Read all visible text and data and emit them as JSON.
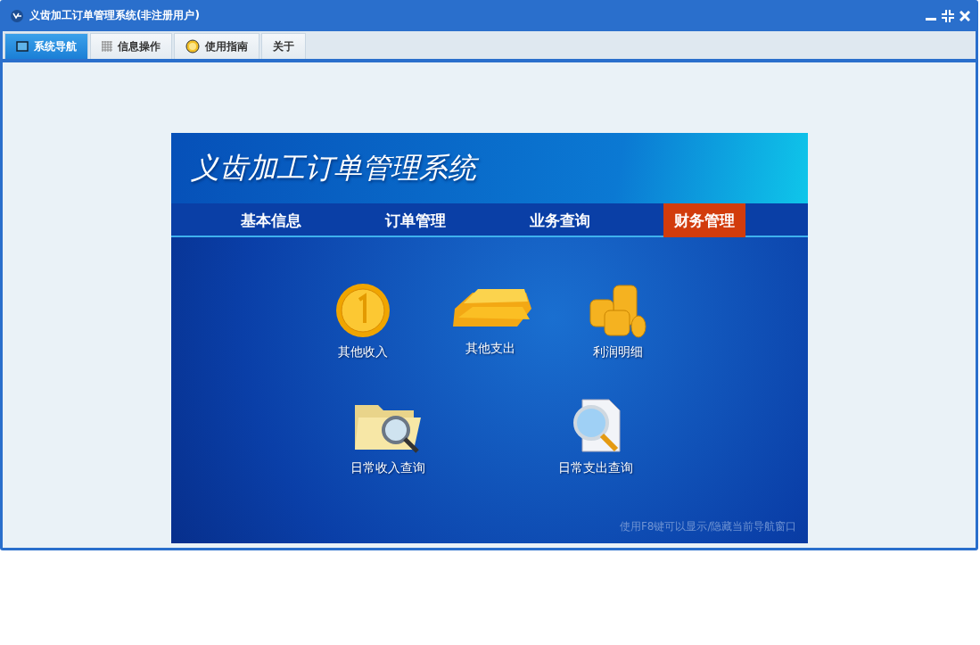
{
  "window": {
    "title": "义齿加工订单管理系统(非注册用户)"
  },
  "tabs": [
    {
      "label": "系统导航",
      "kind": "monitor",
      "selected": true
    },
    {
      "label": "信息操作",
      "kind": "grid",
      "selected": false
    },
    {
      "label": "使用指南",
      "kind": "help",
      "selected": false
    },
    {
      "label": "关于",
      "kind": "plain",
      "selected": false
    }
  ],
  "banner": {
    "title": "义齿加工订单管理系统"
  },
  "nav": [
    {
      "label": "基本信息",
      "selected": false
    },
    {
      "label": "订单管理",
      "selected": false
    },
    {
      "label": "业务查询",
      "selected": false
    },
    {
      "label": "财务管理",
      "selected": true
    }
  ],
  "shortcuts": [
    [
      {
        "label": "其他收入",
        "kind": "coin"
      },
      {
        "label": "其他支出",
        "kind": "bars"
      },
      {
        "label": "利润明细",
        "kind": "stack"
      }
    ],
    [
      {
        "label": "日常收入查询",
        "kind": "folder"
      },
      {
        "label": "日常支出查询",
        "kind": "document"
      }
    ]
  ],
  "hint": "使用F8键可以显示/隐藏当前导航窗口"
}
